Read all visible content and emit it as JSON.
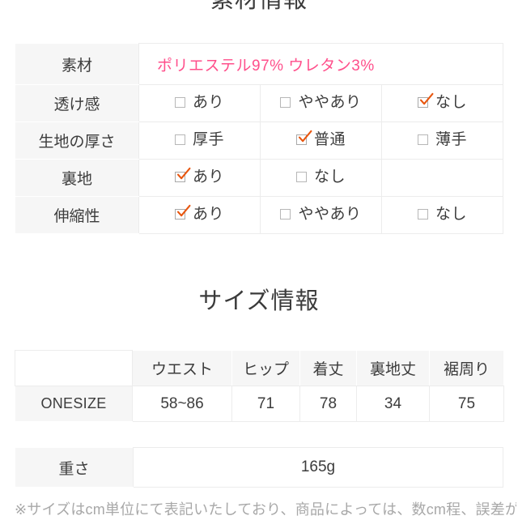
{
  "sections": {
    "material": {
      "title": "素材情報",
      "rows": [
        {
          "label": "素材",
          "type": "text",
          "value": "ポリエステル97% ウレタン3%",
          "value_color": "#ff4f8b"
        },
        {
          "label": "透け感",
          "type": "options",
          "options": [
            {
              "label": "あり",
              "checked": false
            },
            {
              "label": "ややあり",
              "checked": false
            },
            {
              "label": "なし",
              "checked": true
            }
          ]
        },
        {
          "label": "生地の厚さ",
          "type": "options",
          "options": [
            {
              "label": "厚手",
              "checked": false
            },
            {
              "label": "普通",
              "checked": true
            },
            {
              "label": "薄手",
              "checked": false
            }
          ]
        },
        {
          "label": "裏地",
          "type": "options",
          "options": [
            {
              "label": "あり",
              "checked": true
            },
            {
              "label": "なし",
              "checked": false
            },
            {
              "label": "",
              "checked": false,
              "empty": true
            }
          ]
        },
        {
          "label": "伸縮性",
          "type": "options",
          "options": [
            {
              "label": "あり",
              "checked": true
            },
            {
              "label": "ややあり",
              "checked": false
            },
            {
              "label": "なし",
              "checked": false
            }
          ]
        }
      ]
    },
    "size": {
      "title": "サイズ情報",
      "corner": "",
      "headers": [
        "ウエスト",
        "ヒップ",
        "着丈",
        "裏地丈",
        "裾周り"
      ],
      "rows": [
        {
          "label": "ONESIZE",
          "values": [
            "58~86",
            "71",
            "78",
            "34",
            "75"
          ]
        }
      ],
      "weight": {
        "label": "重さ",
        "value": "165g"
      },
      "note": "※サイズはcm単位にて表記いたしており、商品によっては、数cm程、誤差が"
    }
  },
  "colors": {
    "checkmark": "#e8560f",
    "material_value": "#ff4f8b",
    "label_background": "#f6f6f6",
    "border": "#ececec",
    "text": "#3c3c3c",
    "note_text": "#a8a8a8"
  },
  "icons": {
    "checkbox_checked": "checkbox-checked-icon",
    "checkbox_unchecked": "checkbox-unchecked-icon"
  }
}
